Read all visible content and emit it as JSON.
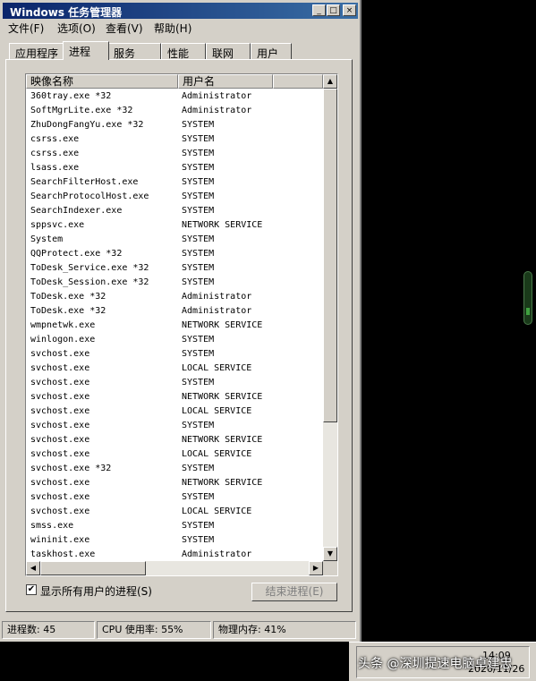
{
  "window": {
    "title": "Windows 任务管理器",
    "controls": {
      "minimize": "_",
      "maximize": "□",
      "close": "×"
    }
  },
  "menu": [
    "文件(F)",
    "选项(O)",
    "查看(V)",
    "帮助(H)"
  ],
  "tabs": [
    "应用程序",
    "进程",
    "服务",
    "性能",
    "联网",
    "用户"
  ],
  "active_tab": "进程",
  "columns": {
    "image_name": "映像名称",
    "user_name": "用户名"
  },
  "processes": [
    {
      "image": "360tray.exe *32",
      "user": "Administrator"
    },
    {
      "image": "SoftMgrLite.exe *32",
      "user": "Administrator"
    },
    {
      "image": "ZhuDongFangYu.exe *32",
      "user": "SYSTEM"
    },
    {
      "image": "csrss.exe",
      "user": "SYSTEM"
    },
    {
      "image": "csrss.exe",
      "user": "SYSTEM"
    },
    {
      "image": "lsass.exe",
      "user": "SYSTEM"
    },
    {
      "image": "SearchFilterHost.exe",
      "user": "SYSTEM"
    },
    {
      "image": "SearchProtocolHost.exe",
      "user": "SYSTEM"
    },
    {
      "image": "SearchIndexer.exe",
      "user": "SYSTEM"
    },
    {
      "image": "sppsvc.exe",
      "user": "NETWORK SERVICE"
    },
    {
      "image": "System",
      "user": "SYSTEM"
    },
    {
      "image": "QQProtect.exe *32",
      "user": "SYSTEM"
    },
    {
      "image": "ToDesk_Service.exe *32",
      "user": "SYSTEM"
    },
    {
      "image": "ToDesk_Session.exe *32",
      "user": "SYSTEM"
    },
    {
      "image": "ToDesk.exe *32",
      "user": "Administrator"
    },
    {
      "image": "ToDesk.exe *32",
      "user": "Administrator"
    },
    {
      "image": "wmpnetwk.exe",
      "user": "NETWORK SERVICE"
    },
    {
      "image": "winlogon.exe",
      "user": "SYSTEM"
    },
    {
      "image": "svchost.exe",
      "user": "SYSTEM"
    },
    {
      "image": "svchost.exe",
      "user": "LOCAL SERVICE"
    },
    {
      "image": "svchost.exe",
      "user": "SYSTEM"
    },
    {
      "image": "svchost.exe",
      "user": "NETWORK SERVICE"
    },
    {
      "image": "svchost.exe",
      "user": "LOCAL SERVICE"
    },
    {
      "image": "svchost.exe",
      "user": "SYSTEM"
    },
    {
      "image": "svchost.exe",
      "user": "NETWORK SERVICE"
    },
    {
      "image": "svchost.exe",
      "user": "LOCAL SERVICE"
    },
    {
      "image": "svchost.exe *32",
      "user": "SYSTEM"
    },
    {
      "image": "svchost.exe",
      "user": "NETWORK SERVICE"
    },
    {
      "image": "svchost.exe",
      "user": "SYSTEM"
    },
    {
      "image": "svchost.exe",
      "user": "LOCAL SERVICE"
    },
    {
      "image": "smss.exe",
      "user": "SYSTEM"
    },
    {
      "image": "wininit.exe",
      "user": "SYSTEM"
    },
    {
      "image": "taskhost.exe",
      "user": "Administrator"
    }
  ],
  "show_all_users": {
    "label": "显示所有用户的进程(S)",
    "checked": true
  },
  "end_process_button": "结束进程(E)",
  "status": {
    "processes": "进程数: 45",
    "cpu": "CPU 使用率: 55%",
    "memory": "物理内存: 41%"
  },
  "taskbar": {
    "time": "14:09",
    "date": "2020/11/26"
  },
  "watermark": "头条 @深圳提速电脑卓建忠",
  "colors": {
    "title_start": "#0a246a",
    "title_end": "#3a6ea5",
    "face": "#d4d0c8",
    "desktop": "#000000"
  }
}
